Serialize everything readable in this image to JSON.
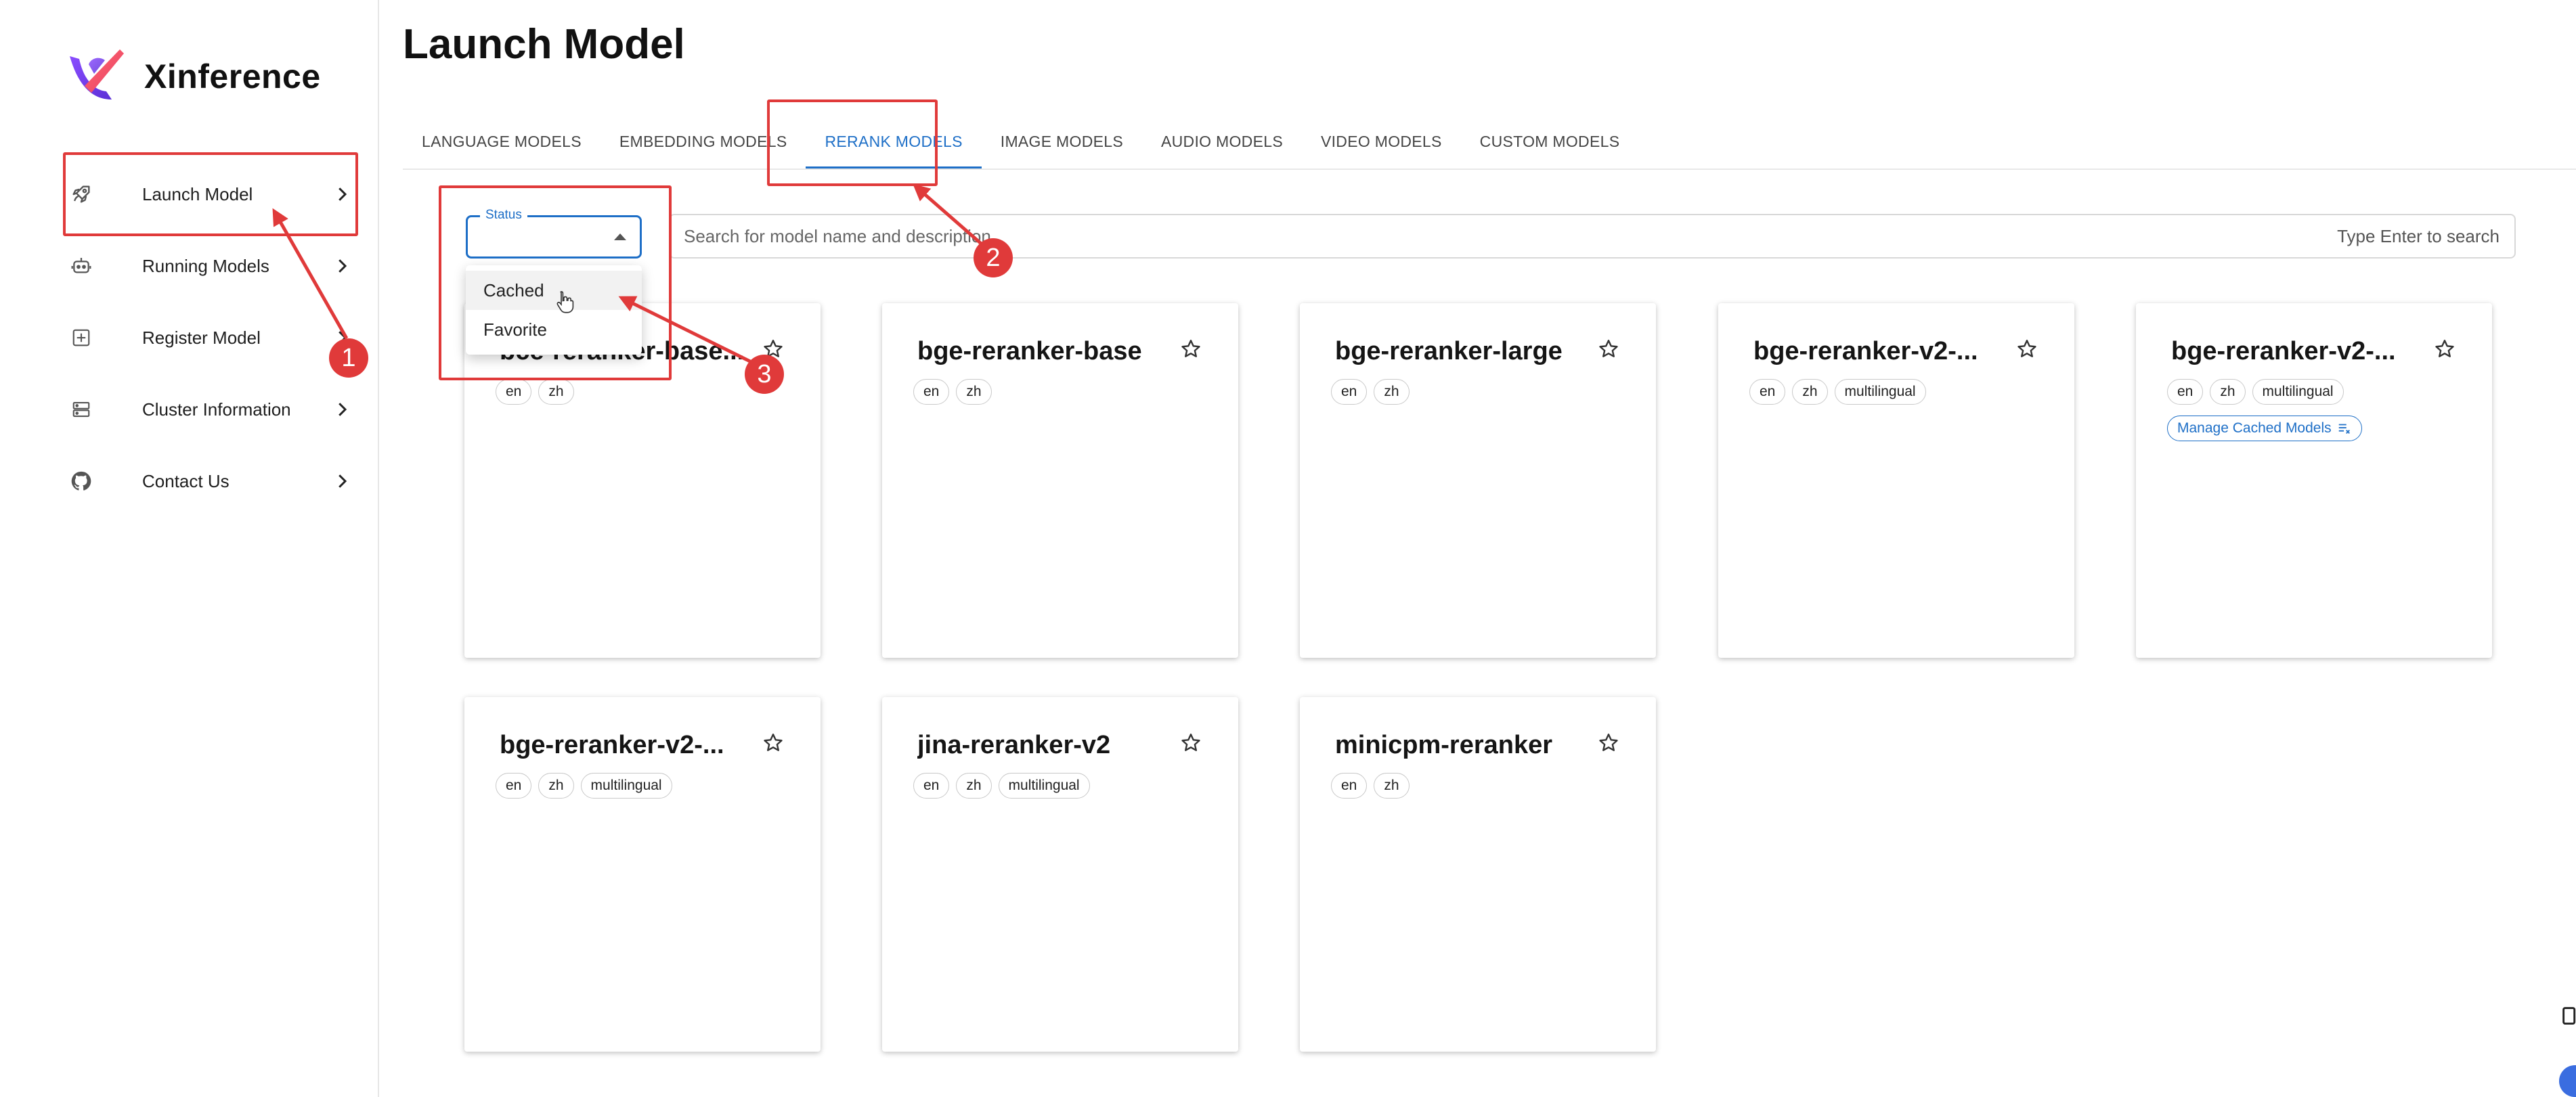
{
  "app": {
    "name": "Xinference"
  },
  "sidebar": {
    "items": [
      {
        "label": "Launch Model",
        "icon": "rocket-icon"
      },
      {
        "label": "Running Models",
        "icon": "robot-icon"
      },
      {
        "label": "Register Model",
        "icon": "add-box-icon"
      },
      {
        "label": "Cluster Information",
        "icon": "server-icon"
      },
      {
        "label": "Contact Us",
        "icon": "github-icon"
      }
    ]
  },
  "page": {
    "title": "Launch Model"
  },
  "tabs": [
    {
      "label": "LANGUAGE MODELS",
      "active": false
    },
    {
      "label": "EMBEDDING MODELS",
      "active": false
    },
    {
      "label": "RERANK MODELS",
      "active": true
    },
    {
      "label": "IMAGE MODELS",
      "active": false
    },
    {
      "label": "AUDIO MODELS",
      "active": false
    },
    {
      "label": "VIDEO MODELS",
      "active": false
    },
    {
      "label": "CUSTOM MODELS",
      "active": false
    }
  ],
  "filter": {
    "status_label": "Status",
    "status_value": "",
    "options": [
      "Cached",
      "Favorite"
    ]
  },
  "search": {
    "placeholder": "Search for model name and description",
    "hint": "Type Enter to search"
  },
  "models": [
    {
      "name": "bce-reranker-base...",
      "tags": [
        "en",
        "zh"
      ]
    },
    {
      "name": "bge-reranker-base",
      "tags": [
        "en",
        "zh"
      ]
    },
    {
      "name": "bge-reranker-large",
      "tags": [
        "en",
        "zh"
      ]
    },
    {
      "name": "bge-reranker-v2-...",
      "tags": [
        "en",
        "zh",
        "multilingual"
      ]
    },
    {
      "name": "bge-reranker-v2-...",
      "tags": [
        "en",
        "zh",
        "multilingual"
      ],
      "manage_label": "Manage Cached Models"
    },
    {
      "name": "bge-reranker-v2-...",
      "tags": [
        "en",
        "zh",
        "multilingual"
      ]
    },
    {
      "name": "jina-reranker-v2",
      "tags": [
        "en",
        "zh",
        "multilingual"
      ]
    },
    {
      "name": "minicpm-reranker",
      "tags": [
        "en",
        "zh"
      ]
    }
  ],
  "annotations": {
    "numbers": [
      "1",
      "2",
      "3"
    ],
    "color": "#e03a3a"
  },
  "colors": {
    "accent": "#1e6fc7",
    "annotation": "#e03a3a"
  }
}
